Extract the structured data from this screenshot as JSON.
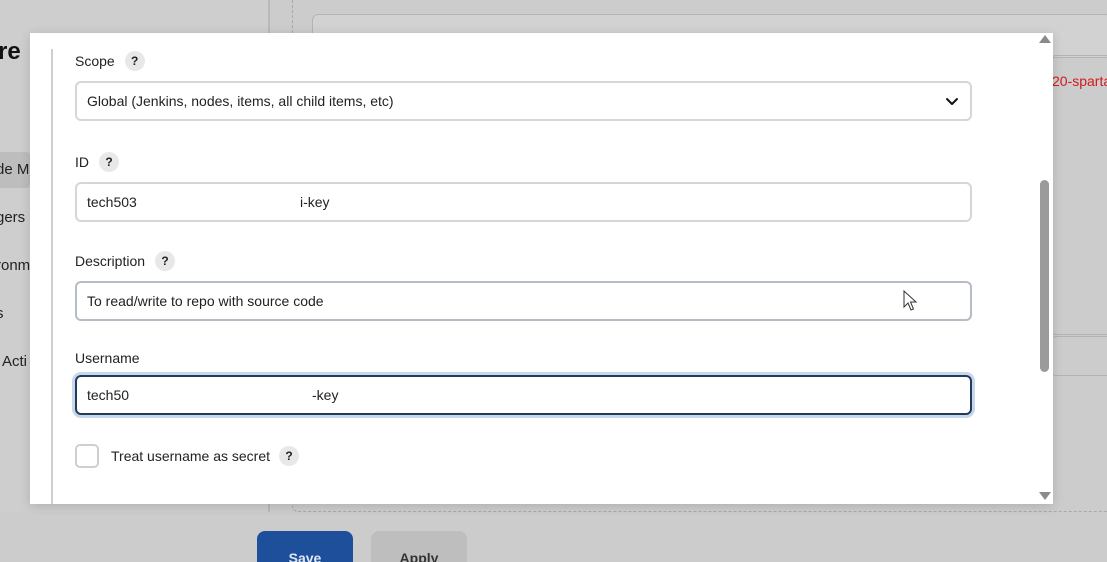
{
  "background": {
    "page_title_fragment": "re",
    "sidebar_items": [
      "de M",
      "gers",
      "ronm",
      "s",
      "Acti"
    ],
    "error_text_fragment": "20-sparta",
    "save_label": "Save",
    "apply_label": "Apply"
  },
  "dialog": {
    "scope": {
      "label": "Scope",
      "help": "?",
      "selected_value": "Global (Jenkins, nodes, items, all child items, etc)"
    },
    "id": {
      "label": "ID",
      "help": "?",
      "value_prefix": "tech503",
      "value_suffix": "i-key"
    },
    "description": {
      "label": "Description",
      "help": "?",
      "value": "To read/write to repo with source code"
    },
    "username": {
      "label": "Username",
      "value_prefix": "tech50",
      "value_suffix": "-key"
    },
    "treat_username_secret": {
      "label": "Treat username as secret",
      "help": "?",
      "checked": false
    }
  },
  "colors": {
    "primary_button": "#1d4f9a",
    "focus_border": "#243a5a",
    "focus_ring": "#c7d8ec",
    "error": "#d21a1a"
  },
  "icons": {
    "scope_dropdown": "chevron-down-icon",
    "cursor": "mouse-pointer-icon"
  }
}
